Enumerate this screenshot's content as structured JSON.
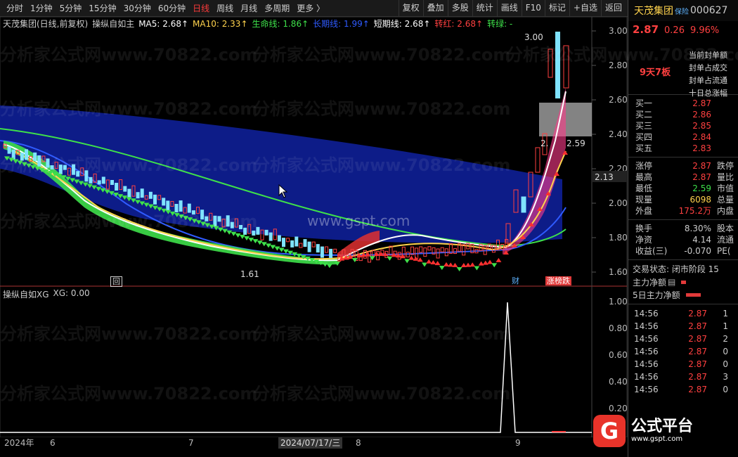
{
  "toolbar": {
    "period_tabs": [
      "分时",
      "1分钟",
      "5分钟",
      "15分钟",
      "30分钟",
      "60分钟",
      "日线",
      "周线",
      "月线",
      "多周期",
      "更多 〉"
    ],
    "active_tab": "日线",
    "buttons": [
      "复权",
      "叠加",
      "多股",
      "统计",
      "画线",
      "F10",
      "标记",
      "+自选",
      "返回"
    ]
  },
  "stock": {
    "name": "天茂集团",
    "tag": "保险",
    "code": "000627",
    "price": "2.87",
    "change": "0.26",
    "change_pct": "9.96%",
    "limit_streak": "9天7板",
    "limit_lines": [
      "当前封单额",
      "封单占成交",
      "封单占流通",
      "十日总涨幅"
    ]
  },
  "main_legend": {
    "title": "天茂集团(日线,前复权)",
    "indicator": "操纵自如主",
    "ma5": "MA5: 2.68↑",
    "ma10": "MA10: 2.33↑",
    "life": "生命线: 1.86↑",
    "long": "长期线: 1.99↑",
    "short": "短期线: 2.68↑",
    "turn_red": "转红: 2.68↑",
    "turn_green": "转绿: -"
  },
  "sub_legend": {
    "title": "操纵自如XG",
    "value": "XG: 0.00"
  },
  "y_axis_main": [
    "3.00",
    "2.80",
    "2.60",
    "2.40",
    "2.20",
    "2.00",
    "1.80",
    "1.60"
  ],
  "y_axis_sub": [
    "1.00",
    "0.80",
    "0.60",
    "0.40",
    "0.20"
  ],
  "current_price_tag": "2.13",
  "annotations": {
    "high": "3.00",
    "low": "1.61",
    "mid": "2.59",
    "mid_left": "2.",
    "badge_cai": "财",
    "badge_lhb": "涨榜跌",
    "badge_box": "回"
  },
  "quotes": [
    {
      "label": "买一",
      "value": "2.87",
      "extra": ""
    },
    {
      "label": "买二",
      "value": "2.86",
      "extra": ""
    },
    {
      "label": "买三",
      "value": "2.85",
      "extra": ""
    },
    {
      "label": "买四",
      "value": "2.84",
      "extra": ""
    },
    {
      "label": "买五",
      "value": "2.83",
      "extra": ""
    }
  ],
  "stats": [
    {
      "label": "涨停",
      "value": "2.87",
      "extra": "跌停",
      "color": "#ff4040"
    },
    {
      "label": "最高",
      "value": "2.87",
      "extra": "量比",
      "color": "#ff4040"
    },
    {
      "label": "最低",
      "value": "2.59",
      "extra": "市值",
      "color": "#3ee04a"
    },
    {
      "label": "现量",
      "value": "6098",
      "extra": "总量",
      "color": "#ffd34d"
    },
    {
      "label": "外盘",
      "value": "175.2万",
      "extra": "内盘",
      "color": "#ff4040"
    }
  ],
  "stats2": [
    {
      "label": "换手",
      "value": "8.30%",
      "extra": "股本",
      "color": "#ccc"
    },
    {
      "label": "净资",
      "value": "4.14",
      "extra": "流通",
      "color": "#ccc"
    },
    {
      "label": "收益(三)",
      "value": "-0.070",
      "extra": "PE(",
      "color": "#ccc"
    }
  ],
  "trade_status": "交易状态: 闭市阶段 15",
  "flows": [
    {
      "label": "主力净额",
      "icon": "▤",
      "bar": 0.12
    },
    {
      "label": "5日主力净额",
      "icon": "",
      "bar": 0.35
    }
  ],
  "ticks": [
    {
      "time": "14:56",
      "price": "2.87",
      "vol": "1"
    },
    {
      "time": "14:56",
      "price": "2.87",
      "vol": "1"
    },
    {
      "time": "14:56",
      "price": "2.87",
      "vol": "2"
    },
    {
      "time": "14:56",
      "price": "2.87",
      "vol": "0"
    },
    {
      "time": "14:56",
      "price": "2.87",
      "vol": "0"
    },
    {
      "time": "14:56",
      "price": "2.87",
      "vol": "3"
    },
    {
      "time": "14:56",
      "price": "2.87",
      "vol": "0"
    }
  ],
  "x_axis": {
    "labels": [
      "2024年",
      "6",
      "7",
      "8",
      "9"
    ],
    "highlight": "2024/07/17/三"
  },
  "watermarks": [
    "分析家公式网www.70822.com",
    "www.gspt.com"
  ],
  "logo": {
    "mark": "G",
    "text": "公式平台",
    "sub": "www.gspt.com"
  },
  "colors": {
    "up": "#ff4040",
    "down": "#3ee04a",
    "band": "#0e1d8f",
    "ma5": "#ffffff",
    "ma10": "#ffd34d",
    "life": "#3ee04a",
    "long": "#2f5bff"
  }
}
